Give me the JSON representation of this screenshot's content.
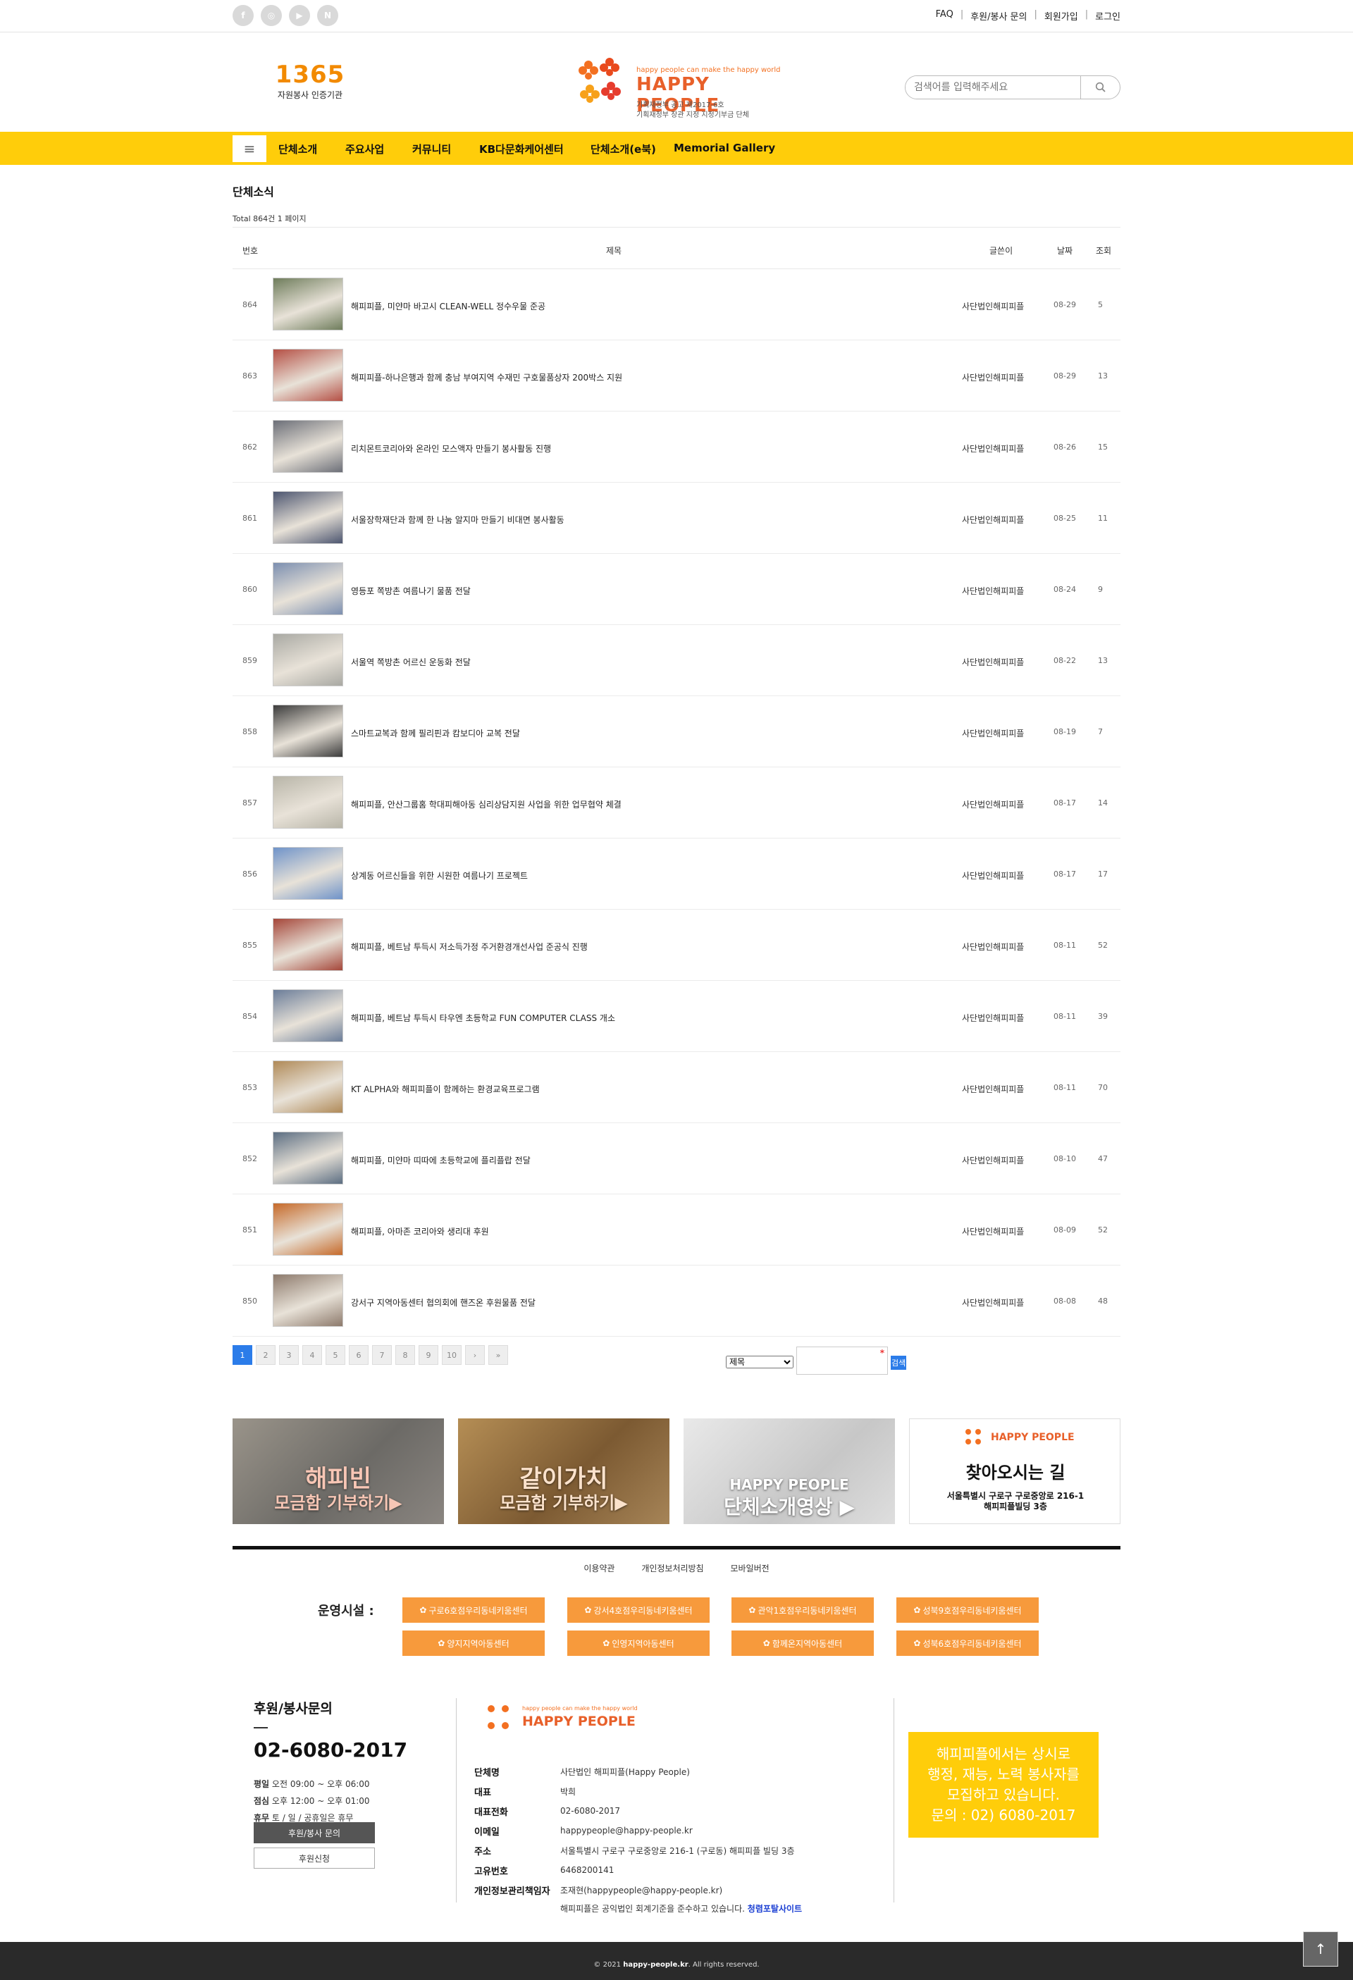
{
  "topbar": {
    "social": [
      "f",
      "◎",
      "▶",
      "N"
    ],
    "links": [
      "FAQ",
      "후원/봉사 문의",
      "회원가입",
      "로그인"
    ]
  },
  "header": {
    "logo1365_text": "자원봉사 인증기관",
    "logo1365_num": "1365",
    "hp_tagline": "happy people can make the happy world",
    "hp_name": "HAPPY PEOPLE",
    "hp_sub1": "기획재정부 공고 제2017-6호",
    "hp_sub2": "기획재정부 장관 지정 지정기부금 단체",
    "search_placeholder": "검색어를 입력해주세요"
  },
  "nav": {
    "menu_icon": "≡",
    "items": [
      "단체소개",
      "주요사업",
      "커뮤니티",
      "KB다문화케어센터",
      "단체소개(e북)",
      "Memorial Gallery"
    ]
  },
  "board": {
    "title": "단체소식",
    "total": "Total 864건 1 페이지",
    "headers": {
      "num": "번호",
      "title": "제목",
      "writer": "글쓴이",
      "date": "날짜",
      "hit": "조회"
    },
    "rows": [
      {
        "num": "864",
        "title": "해피피플, 미얀마 바고시 CLEAN-WELL 정수우물 준공",
        "writer": "사단법인해피피플",
        "date": "08-29",
        "hit": "5"
      },
      {
        "num": "863",
        "title": "해피피플-하나은행과 함께 충남 부여지역 수재민 구호물품상자 200박스 지원",
        "writer": "사단법인해피피플",
        "date": "08-29",
        "hit": "13"
      },
      {
        "num": "862",
        "title": "리치몬트코리아와 온라인 모스액자 만들기 봉사활동 진행",
        "writer": "사단법인해피피플",
        "date": "08-26",
        "hit": "15"
      },
      {
        "num": "861",
        "title": "서울장학재단과 함께 한 나눔 알지마 만들기 비대면 봉사활동",
        "writer": "사단법인해피피플",
        "date": "08-25",
        "hit": "11"
      },
      {
        "num": "860",
        "title": "영등포 쪽방촌 여름나기 물품 전달",
        "writer": "사단법인해피피플",
        "date": "08-24",
        "hit": "9"
      },
      {
        "num": "859",
        "title": "서울역 쪽방촌 어르신 운동화 전달",
        "writer": "사단법인해피피플",
        "date": "08-22",
        "hit": "13"
      },
      {
        "num": "858",
        "title": "스마트교복과 함께 필리핀과 캄보디아 교복 전달",
        "writer": "사단법인해피피플",
        "date": "08-19",
        "hit": "7"
      },
      {
        "num": "857",
        "title": "해피피플, 안산그룹홈 학대피해아동 심리상담지원 사업을 위한 업무협약 체결",
        "writer": "사단법인해피피플",
        "date": "08-17",
        "hit": "14"
      },
      {
        "num": "856",
        "title": "상계동 어르신들을 위한 시원한 여름나기 프로젝트",
        "writer": "사단법인해피피플",
        "date": "08-17",
        "hit": "17"
      },
      {
        "num": "855",
        "title": "해피피플, 베트남 투득시 저소득가정 주거환경개선사업 준공식 진행",
        "writer": "사단법인해피피플",
        "date": "08-11",
        "hit": "52"
      },
      {
        "num": "854",
        "title": "해피피플, 베트남 투득시 타우엔 초등학교 FUN COMPUTER CLASS 개소",
        "writer": "사단법인해피피플",
        "date": "08-11",
        "hit": "39"
      },
      {
        "num": "853",
        "title": "KT ALPHA와 해피피플이 함께하는 환경교육프로그램",
        "writer": "사단법인해피피플",
        "date": "08-11",
        "hit": "70"
      },
      {
        "num": "852",
        "title": "해피피플, 미얀마 띠따에 초등학교에 플리플랍 전달",
        "writer": "사단법인해피피플",
        "date": "08-10",
        "hit": "47"
      },
      {
        "num": "851",
        "title": "해피피플, 아마존 코리아와 생리대 후원",
        "writer": "사단법인해피피플",
        "date": "08-09",
        "hit": "52"
      },
      {
        "num": "850",
        "title": "강서구 지역아동센터 협의회에 핸즈온 후원물품 전달",
        "writer": "사단법인해피피플",
        "date": "08-08",
        "hit": "48"
      }
    ],
    "thumb_colors": [
      "#6f7d5c",
      "#b55045",
      "#6c6f78",
      "#4d5670",
      "#7c8fb0",
      "#a9a9a3",
      "#3c3c3c",
      "#b8b5a8",
      "#6f93c9",
      "#a5473a",
      "#6b7d99",
      "#b08a58",
      "#5c6e82",
      "#c66a2a",
      "#8d7a6c"
    ]
  },
  "pager": {
    "pages": [
      "1",
      "2",
      "3",
      "4",
      "5",
      "6",
      "7",
      "8",
      "9",
      "10",
      "›",
      "»"
    ],
    "current": "1"
  },
  "search_form": {
    "field": "제목",
    "button": "검색",
    "required_mark": "*"
  },
  "banners": [
    {
      "line1": "해피빈",
      "line2": "모금함 기부하기▶"
    },
    {
      "line1": "같이가치",
      "line2": "모금함 기부하기▶"
    },
    {
      "line1": "HAPPY PEOPLE",
      "line2": "단체소개영상 ▶"
    },
    {
      "line1": "찾아오시는 길",
      "line2": "서울특별시 구로구 구로중앙로 216-1",
      "line3": "해피피플빌딩 3층",
      "logo": "HAPPY PEOPLE"
    }
  ],
  "footer": {
    "links": [
      "이용약관",
      "개인정보처리방침",
      "모바일버전"
    ],
    "facilities_label": "운영시설 :",
    "facilities": [
      "구로6호점우리동네키움센터",
      "강서4호점우리동네키움센터",
      "관악1호점우리동네키움센터",
      "성북9호점우리동네키움센터",
      "양지지역아동센터",
      "인영지역아동센터",
      "함께온지역아동센터",
      "성북6호점우리동네키움센터"
    ],
    "contact_title": "후원/봉사문의",
    "phone": "02-6080-2017",
    "hours": [
      {
        "k": "평일",
        "v": "오전 09:00 ~ 오후 06:00"
      },
      {
        "k": "점심",
        "v": "오후 12:00 ~ 오후 01:00"
      },
      {
        "k": "휴무",
        "v": "토 / 일 / 공휴일은 휴무"
      }
    ],
    "btn_inquiry": "후원/봉사 문의",
    "btn_apply": "후원신청",
    "info": [
      {
        "k": "단체명",
        "v": "사단법인 해피피플(Happy People)"
      },
      {
        "k": "대표",
        "v": "박희"
      },
      {
        "k": "대표전화",
        "v": "02-6080-2017"
      },
      {
        "k": "이메일",
        "v": "happypeople@happy-people.kr"
      },
      {
        "k": "주소",
        "v": "서울특별시 구로구 구로중앙로 216-1 (구로동) 해피피플 빌딩 3층"
      },
      {
        "k": "고유번호",
        "v": "6468200141"
      },
      {
        "k": "개인정보관리책임자",
        "v": "조재현(happypeople@happy-people.kr)"
      }
    ],
    "note": "해피피플은 공익법인 회계기준을 준수하고 있습니다.",
    "note_link": "청렴포탈사이트",
    "yellow_box": [
      "해피피플에서는 상시로",
      "행정, 재능, 노력 봉사자를",
      "모집하고 있습니다.",
      "문의 : 02) 6080-2017"
    ],
    "copyright_pre": "© 2021",
    "copyright_site": "happy-people.kr",
    "copyright_post": ". All rights reserved.",
    "top_icon": "↑"
  },
  "colors": {
    "accent": "#ffcd0a",
    "orange": "#f79a3c",
    "brand": "#e8602a",
    "blue": "#2b7ce9"
  }
}
